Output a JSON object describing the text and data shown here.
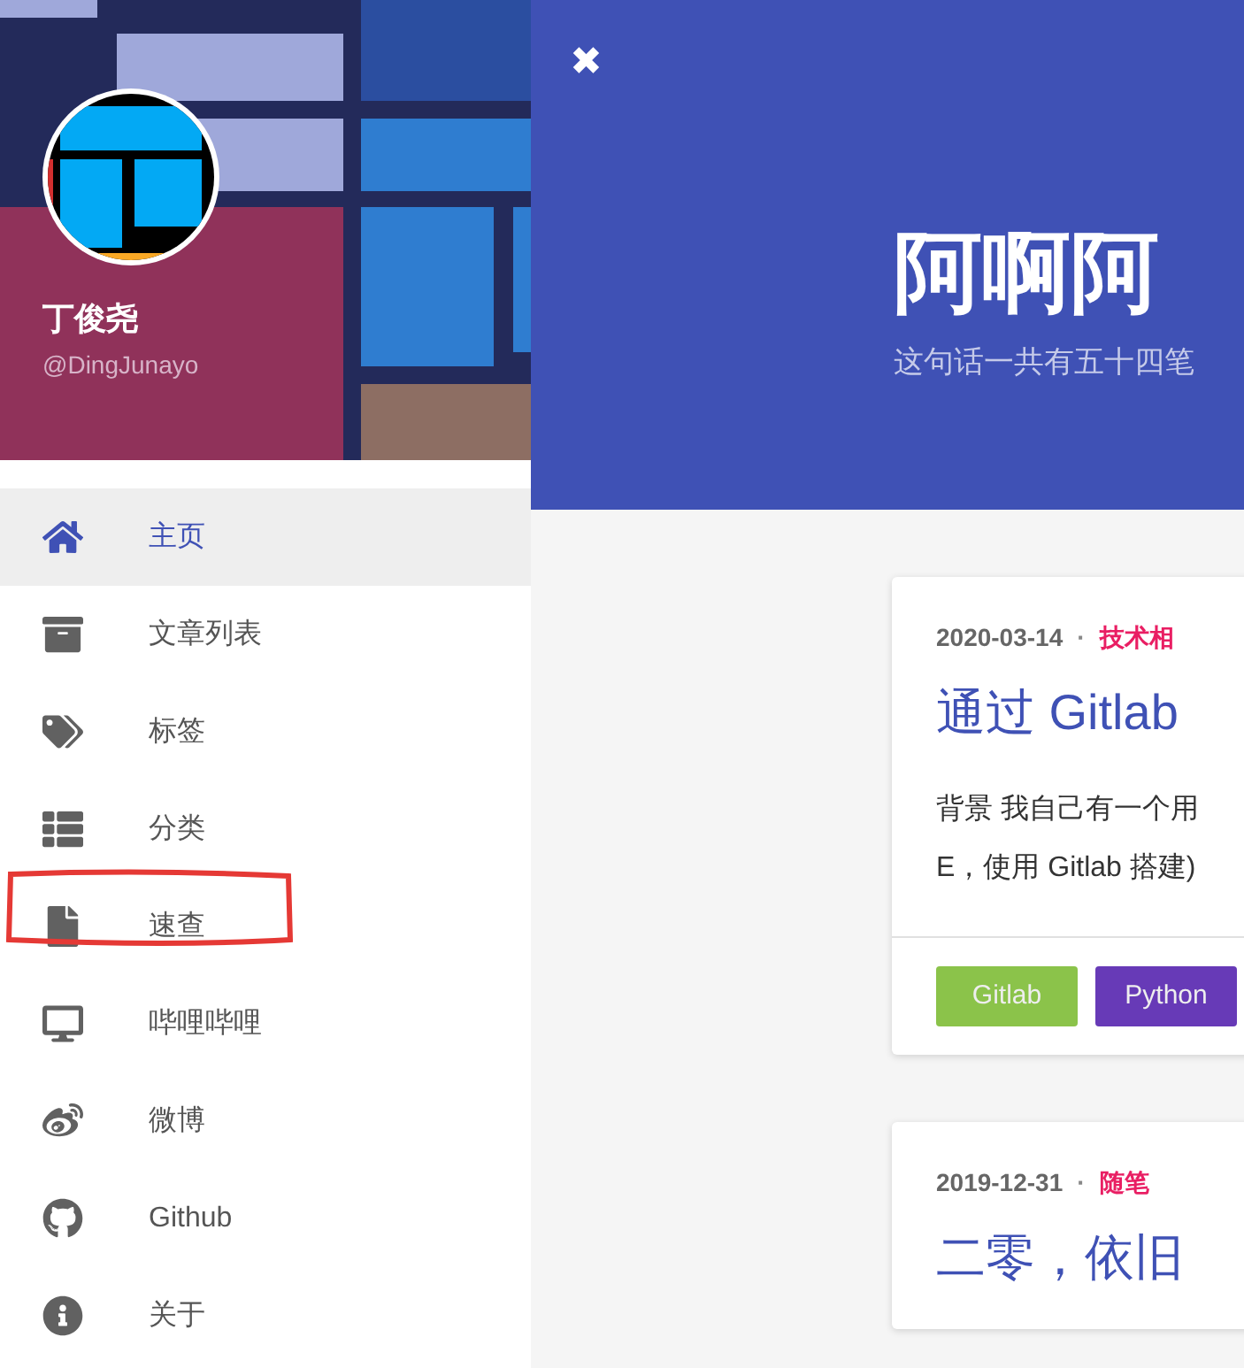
{
  "profile": {
    "name": "丁俊尧",
    "handle": "@DingJunayo"
  },
  "menu": [
    {
      "label": "主页",
      "selected": true
    },
    {
      "label": "文章列表",
      "selected": false
    },
    {
      "label": "标签",
      "selected": false
    },
    {
      "label": "分类",
      "selected": false
    },
    {
      "label": "速查",
      "selected": false
    },
    {
      "label": "哔哩哔哩",
      "selected": false
    },
    {
      "label": "微博",
      "selected": false
    },
    {
      "label": "Github",
      "selected": false
    },
    {
      "label": "关于",
      "selected": false
    }
  ],
  "banner": {
    "close": "✖",
    "title": "阿啊阿",
    "subtitle": "这句话一共有五十四笔"
  },
  "posts": [
    {
      "date": "2020-03-14",
      "separator": "·",
      "category": "技术相",
      "title": "通过 Gitlab",
      "excerpt": [
        "背景 我自己有一个用",
        "E，使用 Gitlab 搭建)"
      ],
      "tags": [
        {
          "label": "Gitlab",
          "color": "#8bc34a"
        },
        {
          "label": "Python",
          "color": "#673ab7"
        }
      ]
    },
    {
      "date": "2019-12-31",
      "separator": "·",
      "category": "随笔",
      "title": "二零，依旧"
    }
  ]
}
